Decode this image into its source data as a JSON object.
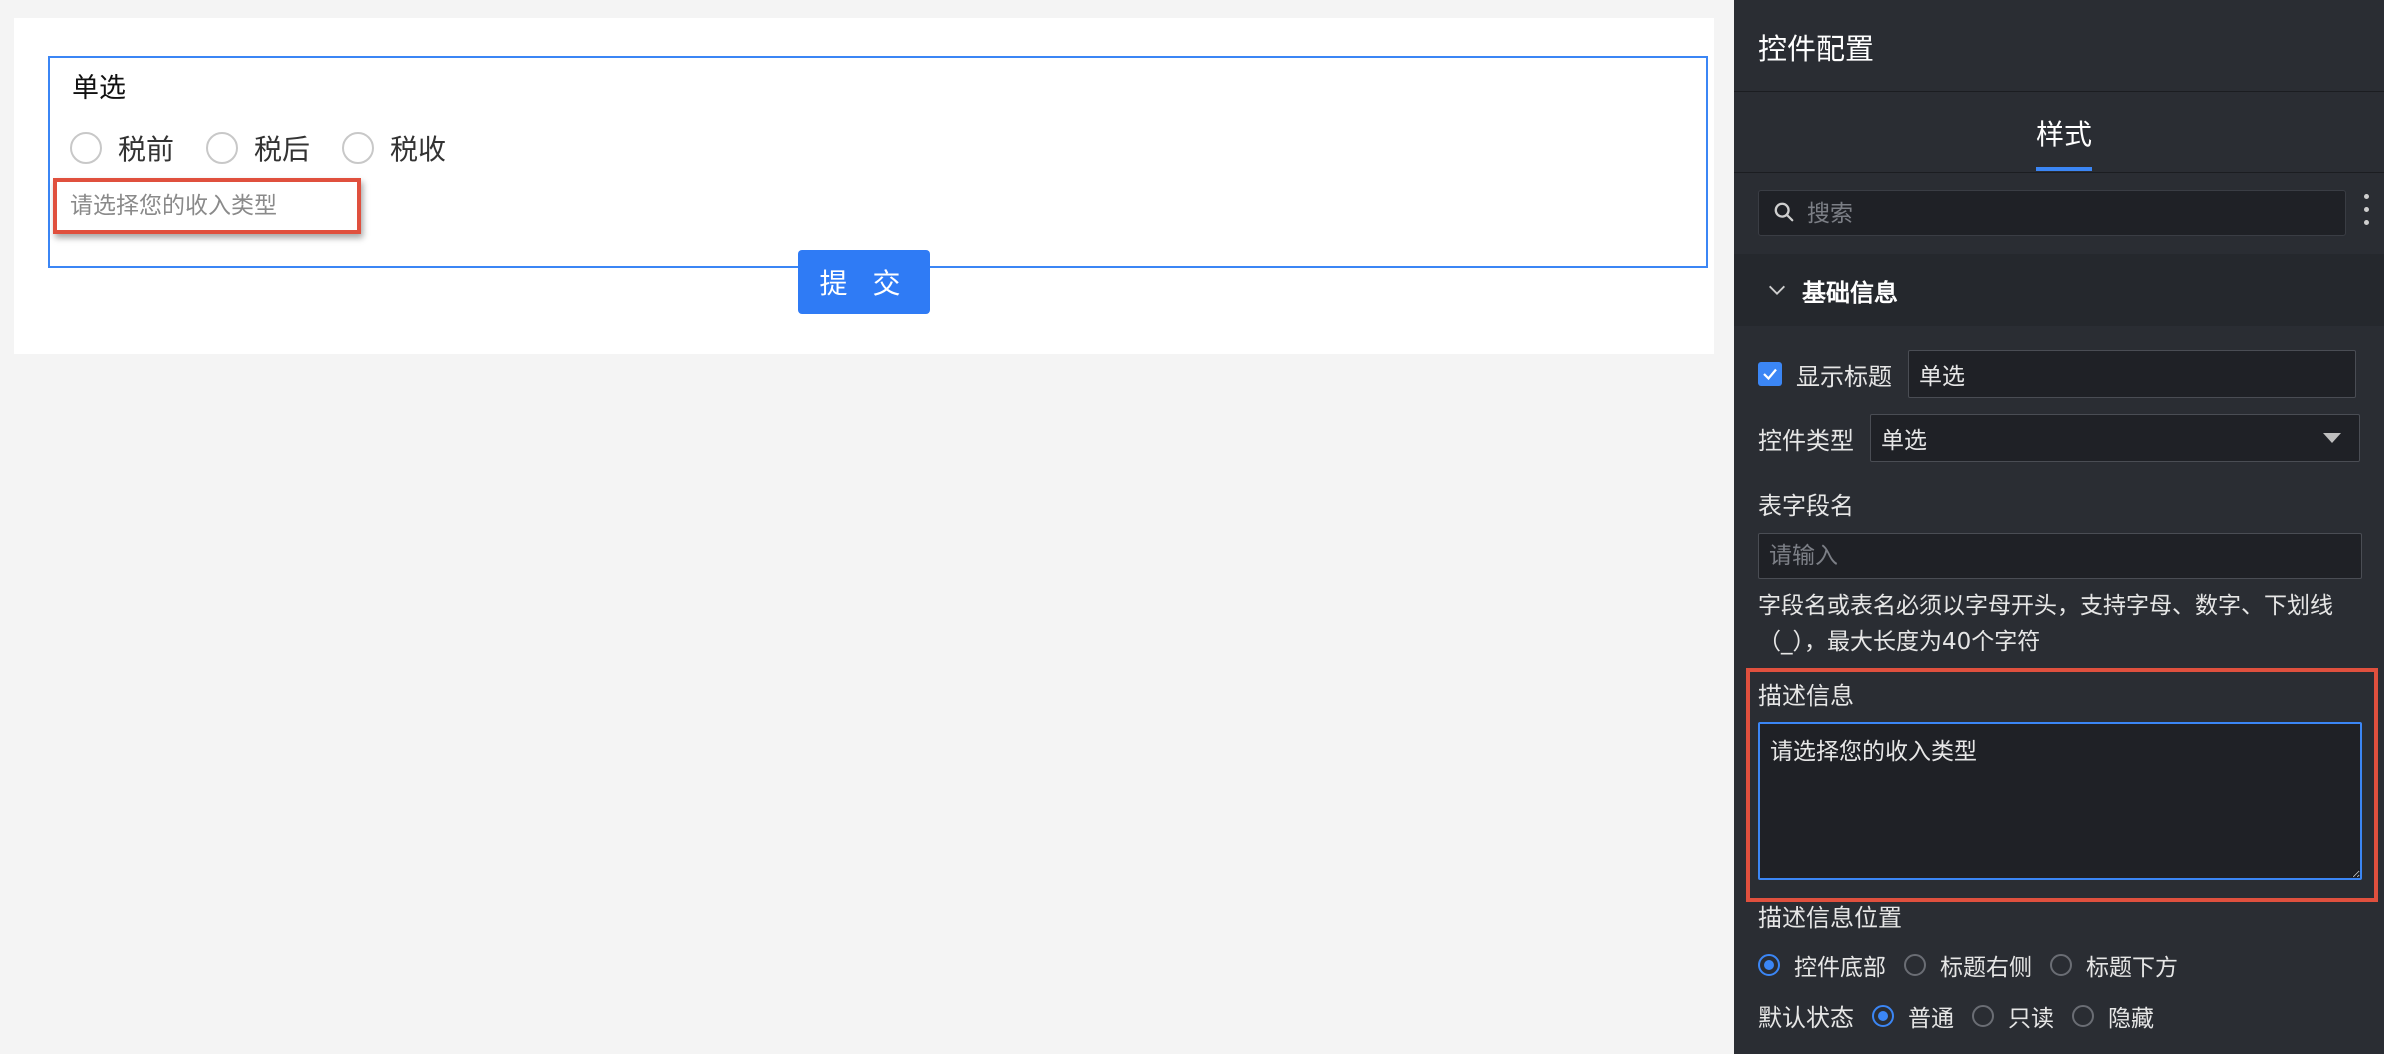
{
  "canvas": {
    "widget": {
      "title": "单选",
      "options": [
        "税前",
        "税后",
        "税收"
      ],
      "description": "请选择您的收入类型"
    },
    "submit_label": "提 交"
  },
  "panel": {
    "header": "控件配置",
    "tab_label": "样式",
    "search_placeholder": "搜索",
    "section_title": "基础信息",
    "show_title_label": "显示标题",
    "show_title_checked": true,
    "title_value": "单选",
    "control_type_label": "控件类型",
    "control_type_value": "单选",
    "field_name_label": "表字段名",
    "field_name_placeholder": "请输入",
    "field_name_hint": "字段名或表名必须以字母开头，支持字母、数字、下划线（_），最大长度为40个字符",
    "description_label": "描述信息",
    "description_value": "请选择您的收入类型",
    "description_position_label": "描述信息位置",
    "description_position_options": [
      "控件底部",
      "标题右侧",
      "标题下方"
    ],
    "description_position_selected": "控件底部",
    "default_state_label": "默认状态",
    "default_state_options": [
      "普通",
      "只读",
      "隐藏"
    ],
    "default_state_selected": "普通"
  },
  "colors": {
    "accent": "#3b86f5",
    "panel_bg": "#2a2d33",
    "highlight": "#e0503e"
  }
}
